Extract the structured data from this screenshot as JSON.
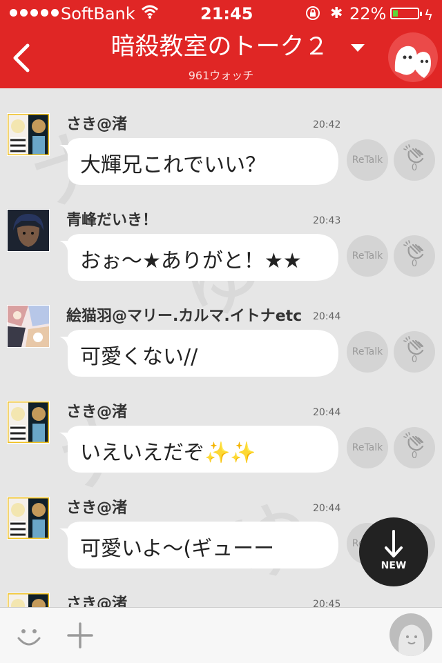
{
  "status_bar": {
    "carrier": "SoftBank",
    "time": "21:45",
    "battery": "22%",
    "battery_level": 0.22,
    "icons": [
      "signal-dots-icon",
      "wifi-icon",
      "rotation-lock-icon",
      "bluetooth-icon",
      "battery-icon",
      "charging-bolt-icon"
    ]
  },
  "header": {
    "title": "暗殺教室のトーク２",
    "watch_count": "961ウォッチ",
    "back_icon": "back-chevron-icon",
    "dropdown_icon": "caret-down-icon",
    "room_icon": "ghost-mascot-icon"
  },
  "messages": [
    {
      "user": "さき@渚",
      "time": "20:42",
      "text": "大輝兄これでいい？",
      "retalk": "ReTalk",
      "claps": "0",
      "avatar": "anime-duo-avatar"
    },
    {
      "user": "青峰だいき！",
      "time": "20:43",
      "text": "おぉ〜★ありがと！★★",
      "retalk": "ReTalk",
      "claps": "0",
      "avatar": "blue-hair-avatar"
    },
    {
      "user": "絵猫羽@マリー.カルマ.イトナetc",
      "time": "20:44",
      "text": "可愛くない//",
      "retalk": "ReTalk",
      "claps": "0",
      "avatar": "anime-collage-avatar"
    },
    {
      "user": "さき@渚",
      "time": "20:44",
      "text": "いえいえだぞ✨✨",
      "retalk": "ReTalk",
      "claps": "0",
      "avatar": "anime-duo-avatar"
    },
    {
      "user": "さき@渚",
      "time": "20:44",
      "text": "可愛いよ〜(ギューー",
      "retalk": "ReTalk",
      "claps": "0",
      "avatar": "anime-duo-avatar"
    },
    {
      "user": "さき@渚",
      "time": "20:45",
      "text": "",
      "retalk": "",
      "claps": "",
      "avatar": "anime-duo-avatar"
    }
  ],
  "new_button": {
    "label": "NEW",
    "icon": "arrow-down-icon"
  },
  "bottom_bar": {
    "icons": [
      "smiley-icon",
      "plus-icon",
      "profile-avatar-icon"
    ]
  },
  "colors": {
    "brand_red": "#e02625",
    "feed_bg": "#e6e6e6",
    "action_circle": "#d4d4d4",
    "new_button_bg": "#222222"
  }
}
